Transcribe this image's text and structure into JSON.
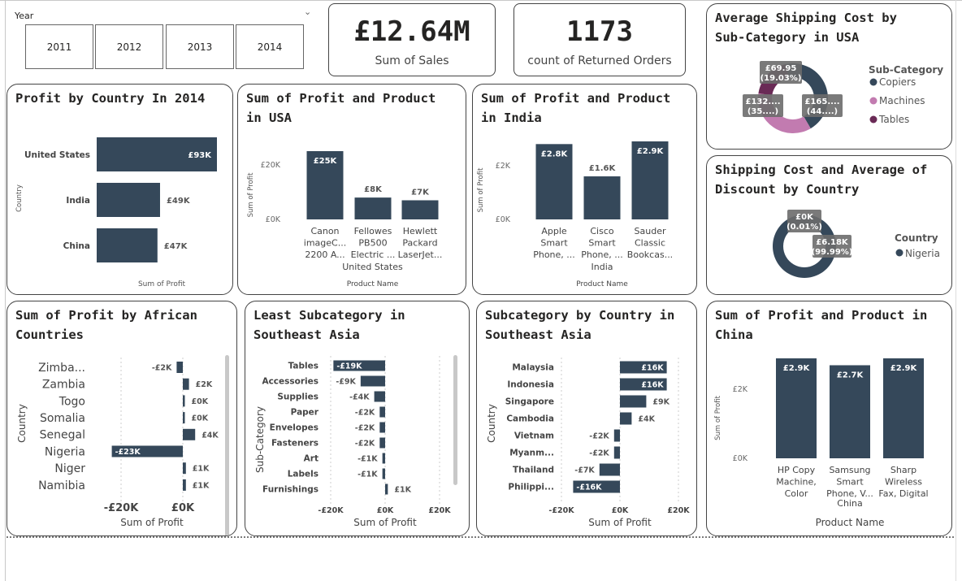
{
  "slicer": {
    "title": "Year",
    "years": [
      "2011",
      "2012",
      "2013",
      "2014"
    ]
  },
  "kpi_sales": {
    "value": "£12.64M",
    "label": "Sum of Sales"
  },
  "kpi_returns": {
    "value": "1173",
    "label": "count of Returned Orders"
  },
  "colors": {
    "bar": "#35485a",
    "copiers": "#35485a",
    "machines": "#c27bb0",
    "tables": "#6a2a56",
    "card_border": "#444444"
  },
  "chart_data": [
    {
      "id": "profit_country_2014",
      "type": "bar",
      "orientation": "horizontal",
      "title": "Profit by Country In 2014",
      "xlabel": "Sum of Profit",
      "ylabel": "Country",
      "categories": [
        "United States",
        "India",
        "China"
      ],
      "values": [
        93000,
        49000,
        47000
      ],
      "data_labels": [
        "£93K",
        "£49K",
        "£47K"
      ],
      "xlim": [
        0,
        93000
      ]
    },
    {
      "id": "profit_product_usa",
      "type": "bar",
      "title": "Sum of Profit and Product in USA",
      "xlabel": "Product Name",
      "ylabel": "Sum of Profit",
      "group_label": "United States",
      "categories": [
        [
          "Canon",
          "imageC...",
          "2200 A..."
        ],
        [
          "Fellowes",
          "PB500",
          "Electric ..."
        ],
        [
          "Hewlett",
          "Packard",
          "LaserJet..."
        ]
      ],
      "values": [
        25000,
        8000,
        7000
      ],
      "data_labels": [
        "£25K",
        "£8K",
        "£7K"
      ],
      "yticks": [
        "£0K",
        "£20K"
      ],
      "ytick_values": [
        0,
        20000
      ],
      "ylim": [
        0,
        25000
      ]
    },
    {
      "id": "profit_product_india",
      "type": "bar",
      "title": "Sum of Profit and Product in India",
      "xlabel": "Product Name",
      "ylabel": "Sum of Profit",
      "group_label": "India",
      "categories": [
        [
          "Apple",
          "Smart",
          "Phone, ..."
        ],
        [
          "Cisco",
          "Smart",
          "Phone, ..."
        ],
        [
          "Sauder",
          "Classic",
          "Bookcas..."
        ]
      ],
      "values": [
        2800,
        1600,
        2900
      ],
      "data_labels": [
        "£2.8K",
        "£1.6K",
        "£2.9K"
      ],
      "yticks": [
        "£0K",
        "£2K"
      ],
      "ytick_values": [
        0,
        2000
      ],
      "ylim": [
        0,
        2900
      ]
    },
    {
      "id": "avg_shipping_usa",
      "type": "pie",
      "donut": true,
      "title": "Average Shipping Cost by Sub-Category in USA",
      "legend_title": "Sub-Category",
      "legend_position": "right",
      "labels": [
        "Copiers",
        "Machines",
        "Tables"
      ],
      "values": [
        165,
        132,
        69.95
      ],
      "percents": [
        44,
        35,
        19.03
      ],
      "slice_labels": [
        [
          "£165....",
          "(44....)"
        ],
        [
          "£132....",
          "(35....)"
        ],
        [
          "£69.95",
          "(19.03%)"
        ]
      ]
    },
    {
      "id": "shipping_discount_country",
      "type": "pie",
      "donut": true,
      "title": "Shipping Cost and Average of Discount by Country",
      "legend_title": "Country",
      "legend_position": "right",
      "labels": [
        "Nigeria"
      ],
      "values": [
        0,
        6180
      ],
      "percents": [
        0.01,
        99.99
      ],
      "slice_labels": [
        [
          "£0K",
          "(0.01%)"
        ],
        [
          "£6.18K",
          "(99.99%)"
        ]
      ]
    },
    {
      "id": "profit_african",
      "type": "bar",
      "orientation": "horizontal",
      "title": "Sum of Profit by African Countries",
      "xlabel": "Sum of Profit",
      "ylabel": "Country",
      "categories": [
        "Zimba...",
        "Zambia",
        "Togo",
        "Somalia",
        "Senegal",
        "Nigeria",
        "Niger",
        "Namibia"
      ],
      "values": [
        -2000,
        2000,
        0,
        0,
        4000,
        -23000,
        1000,
        1000
      ],
      "data_labels": [
        "-£2K",
        "£2K",
        "£0K",
        "£0K",
        "£4K",
        "-£23K",
        "£1K",
        "£1K"
      ],
      "xticks": [
        "-£20K",
        "£0K"
      ],
      "xtick_values": [
        -20000,
        0
      ],
      "xlim": [
        -26000,
        6000
      ]
    },
    {
      "id": "least_subcat_sea",
      "type": "bar",
      "orientation": "horizontal",
      "title": "Least Subcategory in Southeast Asia",
      "xlabel": "Sum of Profit",
      "ylabel": "Sub-Category",
      "categories": [
        "Tables",
        "Accessories",
        "Supplies",
        "Paper",
        "Envelopes",
        "Fasteners",
        "Art",
        "Labels",
        "Furnishings"
      ],
      "values": [
        -19000,
        -9000,
        -4000,
        -2000,
        -2000,
        -2000,
        -1000,
        -1000,
        1000
      ],
      "data_labels": [
        "-£19K",
        "-£9K",
        "-£4K",
        "-£2K",
        "-£2K",
        "-£2K",
        "-£1K",
        "-£1K",
        "£1K"
      ],
      "xticks": [
        "-£20K",
        "£0K",
        "£20K"
      ],
      "xtick_values": [
        -20000,
        0,
        20000
      ],
      "xlim": [
        -20000,
        20000
      ]
    },
    {
      "id": "subcat_country_sea",
      "type": "bar",
      "orientation": "horizontal",
      "title": "Subcategory by Country in Southeast Asia",
      "xlabel": "Sum of Profit",
      "ylabel": "Country",
      "categories": [
        "Malaysia",
        "Indonesia",
        "Singapore",
        "Cambodia",
        "Vietnam",
        "Myanm...",
        "Thailand",
        "Philippi..."
      ],
      "values": [
        16000,
        16000,
        9000,
        4000,
        -2000,
        -2000,
        -7000,
        -16000
      ],
      "data_labels": [
        "£16K",
        "£16K",
        "£9K",
        "£4K",
        "-£2K",
        "-£2K",
        "-£7K",
        "-£16K"
      ],
      "xticks": [
        "-£20K",
        "£0K",
        "£20K"
      ],
      "xtick_values": [
        -20000,
        0,
        20000
      ],
      "xlim": [
        -20000,
        20000
      ]
    },
    {
      "id": "profit_product_china",
      "type": "bar",
      "title": "Sum of Profit and Product in China",
      "xlabel": "Product Name",
      "ylabel": "Sum of Profit",
      "group_label": "China",
      "categories": [
        [
          "HP Copy",
          "Machine,",
          "Color"
        ],
        [
          "Samsung",
          "Smart",
          "Phone, V..."
        ],
        [
          "Sharp",
          "Wireless",
          "Fax, Digital"
        ]
      ],
      "values": [
        2900,
        2700,
        2900
      ],
      "data_labels": [
        "£2.9K",
        "£2.7K",
        "£2.9K"
      ],
      "yticks": [
        "£0K",
        "£2K"
      ],
      "ytick_values": [
        0,
        2000
      ],
      "ylim": [
        0,
        2900
      ]
    }
  ]
}
